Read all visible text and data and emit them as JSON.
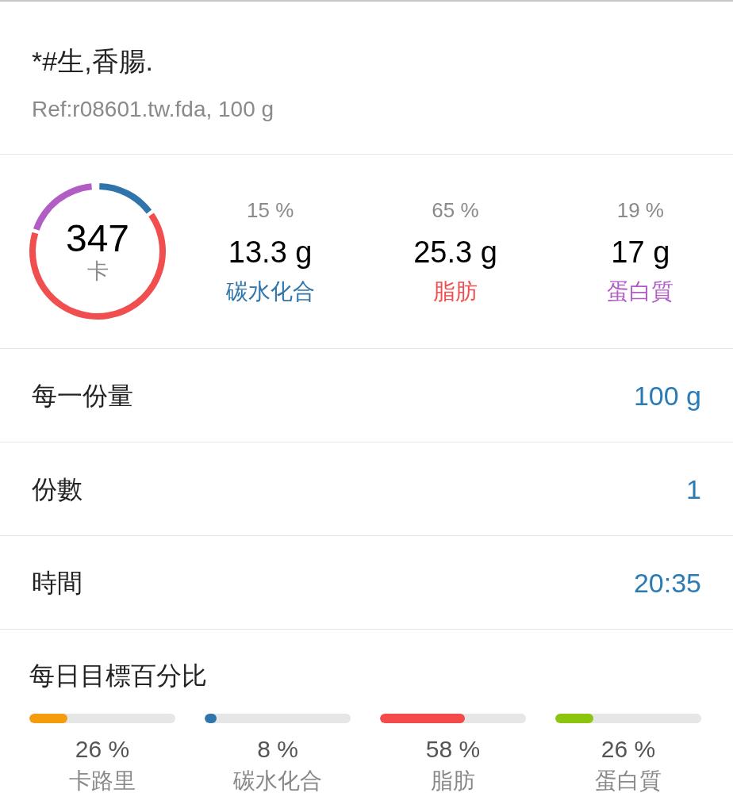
{
  "food": {
    "title": "*#生,香腸.",
    "reference": "Ref:r08601.tw.fda, 100 g"
  },
  "calories": {
    "value": "347",
    "unit": "卡",
    "chart_data": {
      "type": "donut",
      "values": [
        15,
        65,
        19
      ]
    }
  },
  "macros": [
    {
      "percent": "15 %",
      "amount": "13.3 g",
      "label": "碳水化合",
      "color": "#2f74aa"
    },
    {
      "percent": "65 %",
      "amount": "25.3 g",
      "label": "脂肪",
      "color": "#f14f4f"
    },
    {
      "percent": "19 %",
      "amount": "17 g",
      "label": "蛋白質",
      "color": "#b25cc6"
    }
  ],
  "fields": [
    {
      "label": "每一份量",
      "value": "100 g"
    },
    {
      "label": "份數",
      "value": "1"
    },
    {
      "label": "時間",
      "value": "20:35"
    }
  ],
  "daily_goals": {
    "title": "每日目標百分比",
    "items": [
      {
        "percent": "26 %",
        "label": "卡路里",
        "level": 0.26,
        "color": "#f59c0c"
      },
      {
        "percent": "8 %",
        "label": "碳水化合",
        "level": 0.08,
        "color": "#2f74aa"
      },
      {
        "percent": "58 %",
        "label": "脂肪",
        "level": 0.58,
        "color": "#f44a4a"
      },
      {
        "percent": "26 %",
        "label": "蛋白質",
        "level": 0.26,
        "color": "#8dc40d"
      }
    ]
  }
}
